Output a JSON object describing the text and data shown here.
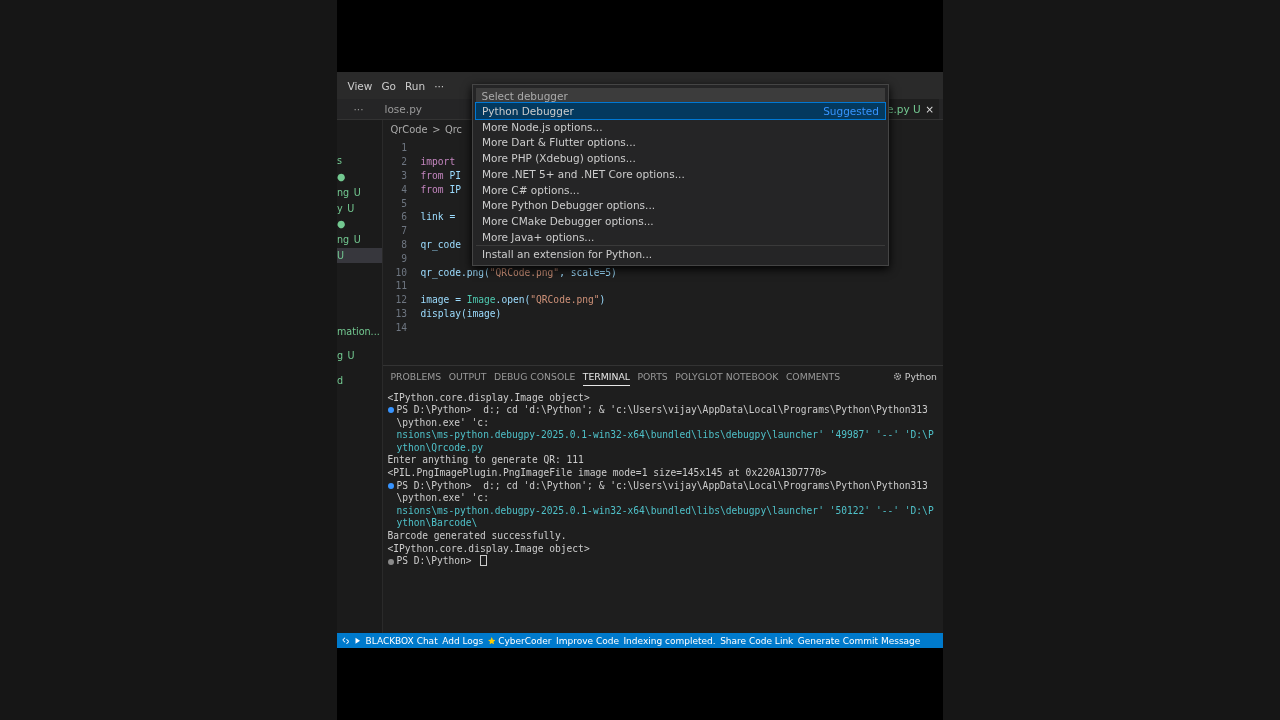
{
  "menu": [
    "View",
    "Go",
    "Run",
    "···"
  ],
  "tabs": [
    {
      "label": "···",
      "selected": false
    },
    {
      "label": "lose.py",
      "selected": false
    },
    {
      "label": "e.py U",
      "selected": true
    }
  ],
  "close_glyph": "×",
  "breadcrumb": [
    "QrCode",
    ">",
    "Qrc"
  ],
  "sidebar": {
    "groups": [
      [
        {
          "text": "s"
        },
        {
          "badge": "●"
        },
        {
          "text": "ng",
          "badge": "U"
        },
        {
          "text": "y",
          "badge": "U"
        },
        {
          "badge": "●"
        },
        {
          "text": "ng",
          "badge": "U"
        },
        {
          "badge": "U",
          "selected": true
        }
      ],
      [
        {
          "text": "mation..."
        },
        {
          "text": "g",
          "badge": "U"
        },
        {
          "text": "d"
        }
      ]
    ]
  },
  "code": [
    {
      "n": "1"
    },
    {
      "n": "2",
      "segs": [
        {
          "t": "import",
          "kind": "kw"
        }
      ]
    },
    {
      "n": "3",
      "segs": [
        {
          "t": "from",
          "kind": "kw"
        },
        {
          "t": " PI",
          "kind": "id"
        }
      ]
    },
    {
      "n": "4",
      "segs": [
        {
          "t": "from",
          "kind": "kw"
        },
        {
          "t": " IP",
          "kind": "id"
        }
      ]
    },
    {
      "n": "5"
    },
    {
      "n": "6",
      "segs": [
        {
          "t": "link = ",
          "kind": "id"
        }
      ]
    },
    {
      "n": "7"
    },
    {
      "n": "8",
      "segs": [
        {
          "t": "qr_code",
          "kind": "id"
        }
      ]
    },
    {
      "n": "9"
    },
    {
      "n": "10",
      "segs": [
        {
          "t": "qr_code.png(",
          "kind": "id"
        },
        {
          "t": "\"QRCode.png\"",
          "kind": "str"
        },
        {
          "t": ", scale=5)",
          "kind": "id"
        }
      ]
    },
    {
      "n": "11"
    },
    {
      "n": "12",
      "segs": [
        {
          "t": "image = ",
          "kind": "id"
        },
        {
          "t": "Image",
          "kind": "cls"
        },
        {
          "t": ".open(",
          "kind": "id"
        },
        {
          "t": "\"QRCode.png\"",
          "kind": "str"
        },
        {
          "t": ")",
          "kind": "id"
        }
      ]
    },
    {
      "n": "13",
      "segs": [
        {
          "t": "display(image)",
          "kind": "id"
        }
      ]
    },
    {
      "n": "14"
    }
  ],
  "palette": {
    "placeholder": "Select debugger",
    "items": [
      {
        "label": "Python Debugger",
        "hint": "Suggested",
        "selected": true
      },
      {
        "label": "More Node.js options...",
        "selected": false
      },
      {
        "label": "More Dart & Flutter options...",
        "selected": false
      },
      {
        "label": "More PHP (Xdebug) options...",
        "selected": false
      },
      {
        "label": "More .NET 5+ and .NET Core options...",
        "selected": false
      },
      {
        "label": "More C# options...",
        "selected": false
      },
      {
        "label": "More Python Debugger options...",
        "selected": false
      },
      {
        "label": "More CMake Debugger options...",
        "selected": false
      },
      {
        "label": "More Java+ options...",
        "selected": false
      },
      {
        "label": "Install an extension for Python...",
        "selected": false
      }
    ]
  },
  "panel": {
    "tabs": [
      {
        "label": "PROBLEMS",
        "selected": false
      },
      {
        "label": "OUTPUT",
        "selected": false
      },
      {
        "label": "DEBUG CONSOLE",
        "selected": false
      },
      {
        "label": "TERMINAL",
        "selected": true
      },
      {
        "label": "PORTS",
        "selected": false
      },
      {
        "label": "POLYGLOT NOTEBOOK",
        "selected": false
      },
      {
        "label": "COMMENTS",
        "selected": false
      }
    ],
    "profile": "Python",
    "lines": [
      {
        "kind": "output",
        "text": "<IPython.core.display.Image object>"
      },
      {
        "kind": "prompt",
        "color": "#3794ff",
        "text": "PS D:\\Python>  d:; cd 'd:\\Python'; & 'c:\\Users\\vijay\\AppData\\Local\\Programs\\Python\\Python313\\python.exe' 'c:"
      },
      {
        "kind": "continued",
        "text": "nsions\\ms-python.debugpy-2025.0.1-win32-x64\\bundled\\libs\\debugpy\\launcher' '49987' '--' 'D:\\Python\\Qrcode.py"
      },
      {
        "kind": "output",
        "text": "Enter anything to generate QR: 111"
      },
      {
        "kind": "output",
        "text": "<PIL.PngImagePlugin.PngImageFile image mode=1 size=145x145 at 0x220A13D7770>"
      },
      {
        "kind": "prompt",
        "color": "#3794ff",
        "text": "PS D:\\Python>  d:; cd 'd:\\Python'; & 'c:\\Users\\vijay\\AppData\\Local\\Programs\\Python\\Python313\\python.exe' 'c:"
      },
      {
        "kind": "continued",
        "text": "nsions\\ms-python.debugpy-2025.0.1-win32-x64\\bundled\\libs\\debugpy\\launcher' '50122' '--' 'D:\\Python\\Barcode\\"
      },
      {
        "kind": "output",
        "text": "Barcode generated successfully."
      },
      {
        "kind": "output",
        "text": "<IPython.core.display.Image object>"
      },
      {
        "kind": "prompt",
        "color": "#8a8a8a",
        "text": "PS D:\\Python> "
      }
    ]
  },
  "status_bar": [
    {
      "text": "BLACKBOX Chat",
      "kind": "text"
    },
    {
      "text": "Add Logs",
      "kind": "text"
    },
    {
      "text": "CyberCoder",
      "kind": "icon"
    },
    {
      "text": "Improve Code",
      "kind": "text"
    },
    {
      "text": "Indexing completed.",
      "kind": "text"
    },
    {
      "text": "Share Code Link",
      "kind": "text"
    },
    {
      "text": "Generate Commit Message",
      "kind": "text"
    }
  ]
}
